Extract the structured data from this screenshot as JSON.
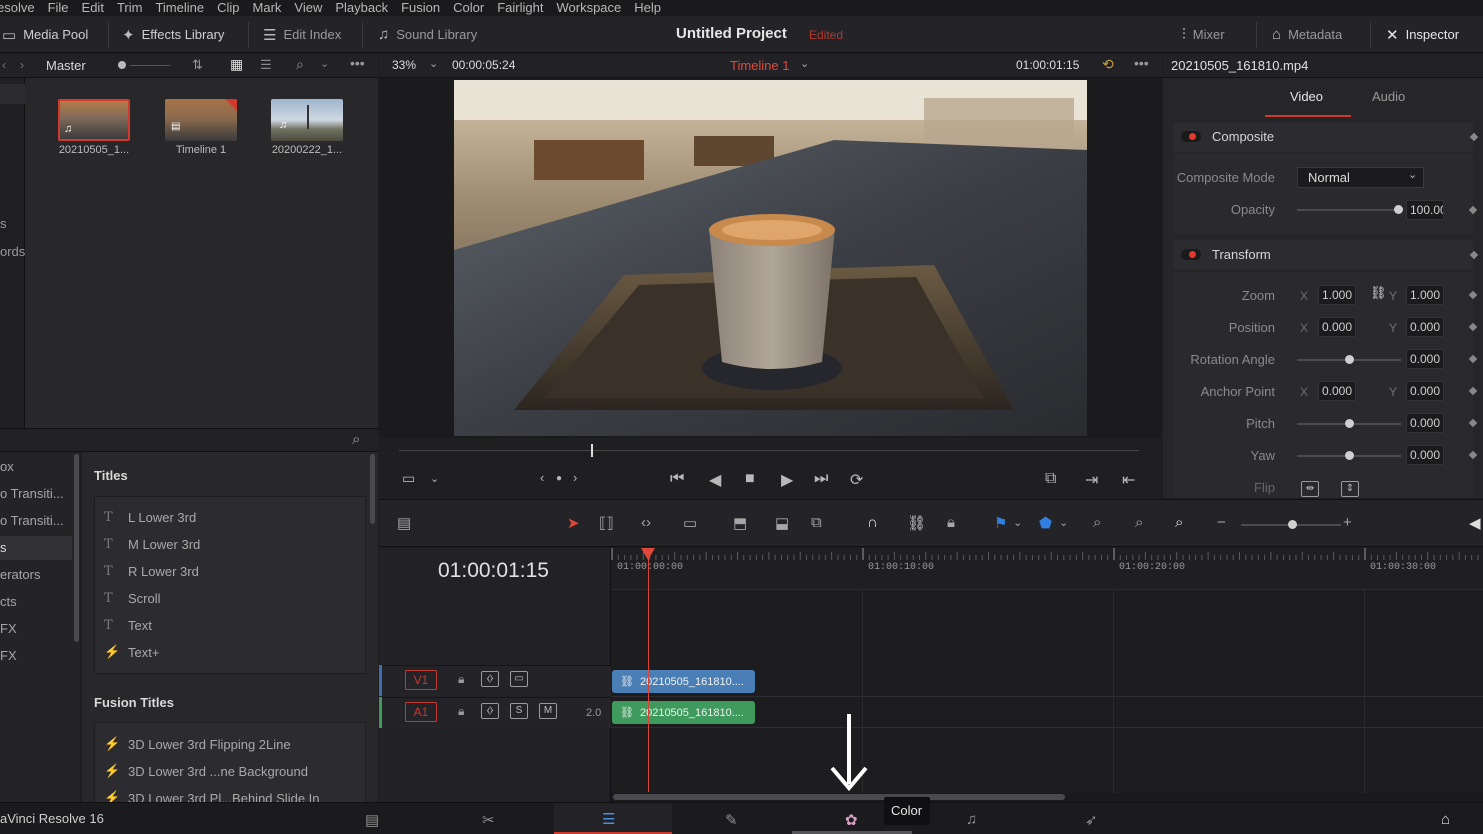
{
  "menu": [
    "esolve",
    "File",
    "Edit",
    "Trim",
    "Timeline",
    "Clip",
    "Mark",
    "View",
    "Playback",
    "Fusion",
    "Color",
    "Fairlight",
    "Workspace",
    "Help"
  ],
  "toolbar": {
    "media_pool": "Media Pool",
    "effects_library": "Effects Library",
    "edit_index": "Edit Index",
    "sound_library": "Sound Library",
    "project_title": "Untitled Project",
    "edited": "Edited",
    "mixer": "Mixer",
    "metadata": "Metadata",
    "inspector": "Inspector"
  },
  "media_pool": {
    "bin": "Master",
    "side_labels": [
      "s",
      "ords"
    ],
    "clips": [
      {
        "name": "20210505_1..."
      },
      {
        "name": "Timeline 1"
      },
      {
        "name": "20200222_1..."
      }
    ]
  },
  "effects": {
    "categories": [
      "ox",
      "o Transiti...",
      "o Transiti...",
      "s",
      "erators",
      "cts",
      "FX",
      "FX"
    ],
    "titles_header": "Titles",
    "titles": [
      "L Lower 3rd",
      "M Lower 3rd",
      "R Lower 3rd",
      "Scroll",
      "Text",
      "Text+"
    ],
    "fusion_header": "Fusion Titles",
    "fusion_titles": [
      "3D Lower 3rd Flipping 2Line",
      "3D Lower 3rd ...ne Background",
      "3D Lower 3rd Pl...Behind Slide In"
    ]
  },
  "viewer": {
    "zoom": "33%",
    "duration": "00:00:05:24",
    "timeline_name": "Timeline 1",
    "timecode": "01:00:01:15"
  },
  "inspector": {
    "clip_name": "20210505_161810.mp4",
    "tab_video": "Video",
    "tab_audio": "Audio",
    "composite": {
      "title": "Composite",
      "mode_label": "Composite Mode",
      "mode_value": "Normal",
      "opacity_label": "Opacity",
      "opacity_value": "100.00"
    },
    "transform": {
      "title": "Transform",
      "zoom_label": "Zoom",
      "zoom_x": "1.000",
      "zoom_y": "1.000",
      "position_label": "Position",
      "position_x": "0.000",
      "position_y": "0.000",
      "rotation_label": "Rotation Angle",
      "rotation_value": "0.000",
      "anchor_label": "Anchor Point",
      "anchor_x": "0.000",
      "anchor_y": "0.000",
      "pitch_label": "Pitch",
      "pitch_value": "0.000",
      "yaw_label": "Yaw",
      "yaw_value": "0.000",
      "flip_label": "Flip"
    },
    "x": "X",
    "y": "Y"
  },
  "timeline": {
    "timecode": "01:00:01:15",
    "ruler": [
      "01:00:00:00",
      "01:00:10:00",
      "01:00:20:00",
      "01:00:30:00"
    ],
    "v1": "V1",
    "a1": "A1",
    "audio_channels": "2.0",
    "solo": "S",
    "mute": "M",
    "video_clip": "20210505_161810....",
    "audio_clip": "20210505_161810...."
  },
  "pagebar": {
    "app_name": "aVinci Resolve 16",
    "tooltip": "Color"
  },
  "colors": {
    "accent_red": "#e03a2e",
    "video_clip": "#4a7fb5",
    "audio_clip": "#3f9a5d"
  }
}
